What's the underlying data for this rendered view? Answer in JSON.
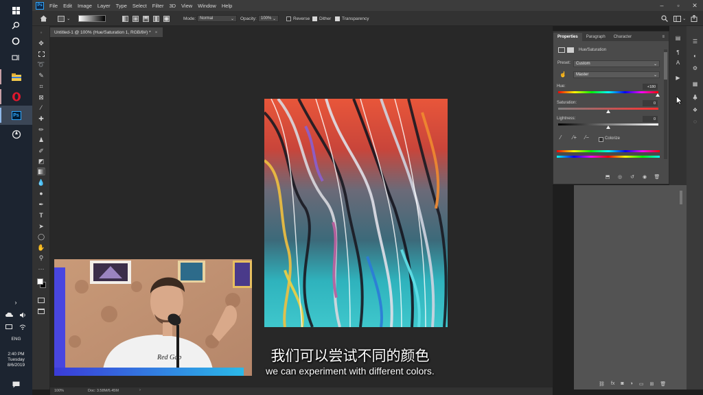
{
  "taskbar": {
    "clock_time": "2:40 PM",
    "clock_day": "Tuesday",
    "clock_date": "8/6/2019",
    "language": "ENG",
    "app_ps_label": "Ps"
  },
  "menubar": {
    "logo": "Ps",
    "items": [
      "File",
      "Edit",
      "Image",
      "Layer",
      "Type",
      "Select",
      "Filter",
      "3D",
      "View",
      "Window",
      "Help"
    ]
  },
  "options": {
    "mode_label": "Mode:",
    "mode_value": "Normal",
    "opacity_label": "Opacity:",
    "opacity_value": "100%",
    "reverse_label": "Reverse",
    "dither_label": "Dither",
    "transparency_label": "Transparency"
  },
  "document": {
    "tab_title": "Untitled-1 @ 100% (Hue/Saturation 1, RGB/8#) *",
    "close": "×"
  },
  "status": {
    "zoom": "100%",
    "doc_size": "Doc: 3.58M/6.45M"
  },
  "properties": {
    "tabs": [
      "Properties",
      "Paragraph",
      "Character"
    ],
    "adjustment_name": "Hue/Saturation",
    "preset_label": "Preset:",
    "preset_value": "Custom",
    "channel_value": "Master",
    "hue_label": "Hue:",
    "hue_value": "+180",
    "saturation_label": "Saturation:",
    "saturation_value": "0",
    "lightness_label": "Lightness:",
    "lightness_value": "0",
    "colorize_label": "Colorize"
  },
  "subtitles": {
    "chinese": "我们可以尝试不同的颜色",
    "english": "we can experiment with different colors."
  },
  "webcam": {
    "shirt_text": "Red Gap"
  }
}
